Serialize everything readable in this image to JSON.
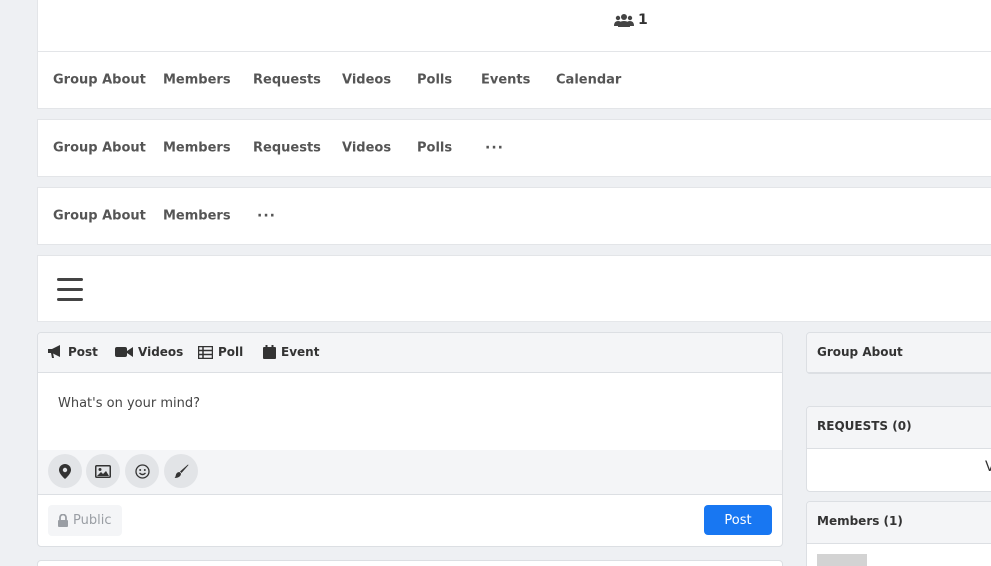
{
  "header": {
    "members_count": "1"
  },
  "nav_rows": [
    {
      "items": [
        "Group About",
        "Members",
        "Requests",
        "Videos",
        "Polls",
        "Events",
        "Calendar"
      ]
    },
    {
      "items": [
        "Group About",
        "Members",
        "Requests",
        "Videos",
        "Polls"
      ],
      "more": "···"
    },
    {
      "items": [
        "Group About",
        "Members"
      ],
      "more": "···"
    }
  ],
  "composer": {
    "tabs": [
      "Post",
      "Videos",
      "Poll",
      "Event"
    ],
    "placeholder": "What's on your mind?",
    "tools": [
      "location-icon",
      "image-icon",
      "emoji-icon",
      "brush-icon"
    ],
    "privacy_label": "Public",
    "post_button": "Post"
  },
  "sidebar": {
    "about_title": "Group About",
    "requests_title": "REQUESTS (0)",
    "requests_peek": "V",
    "members_title": "Members (1)"
  },
  "colors": {
    "accent": "#1877f2",
    "background": "#eef0f3"
  }
}
